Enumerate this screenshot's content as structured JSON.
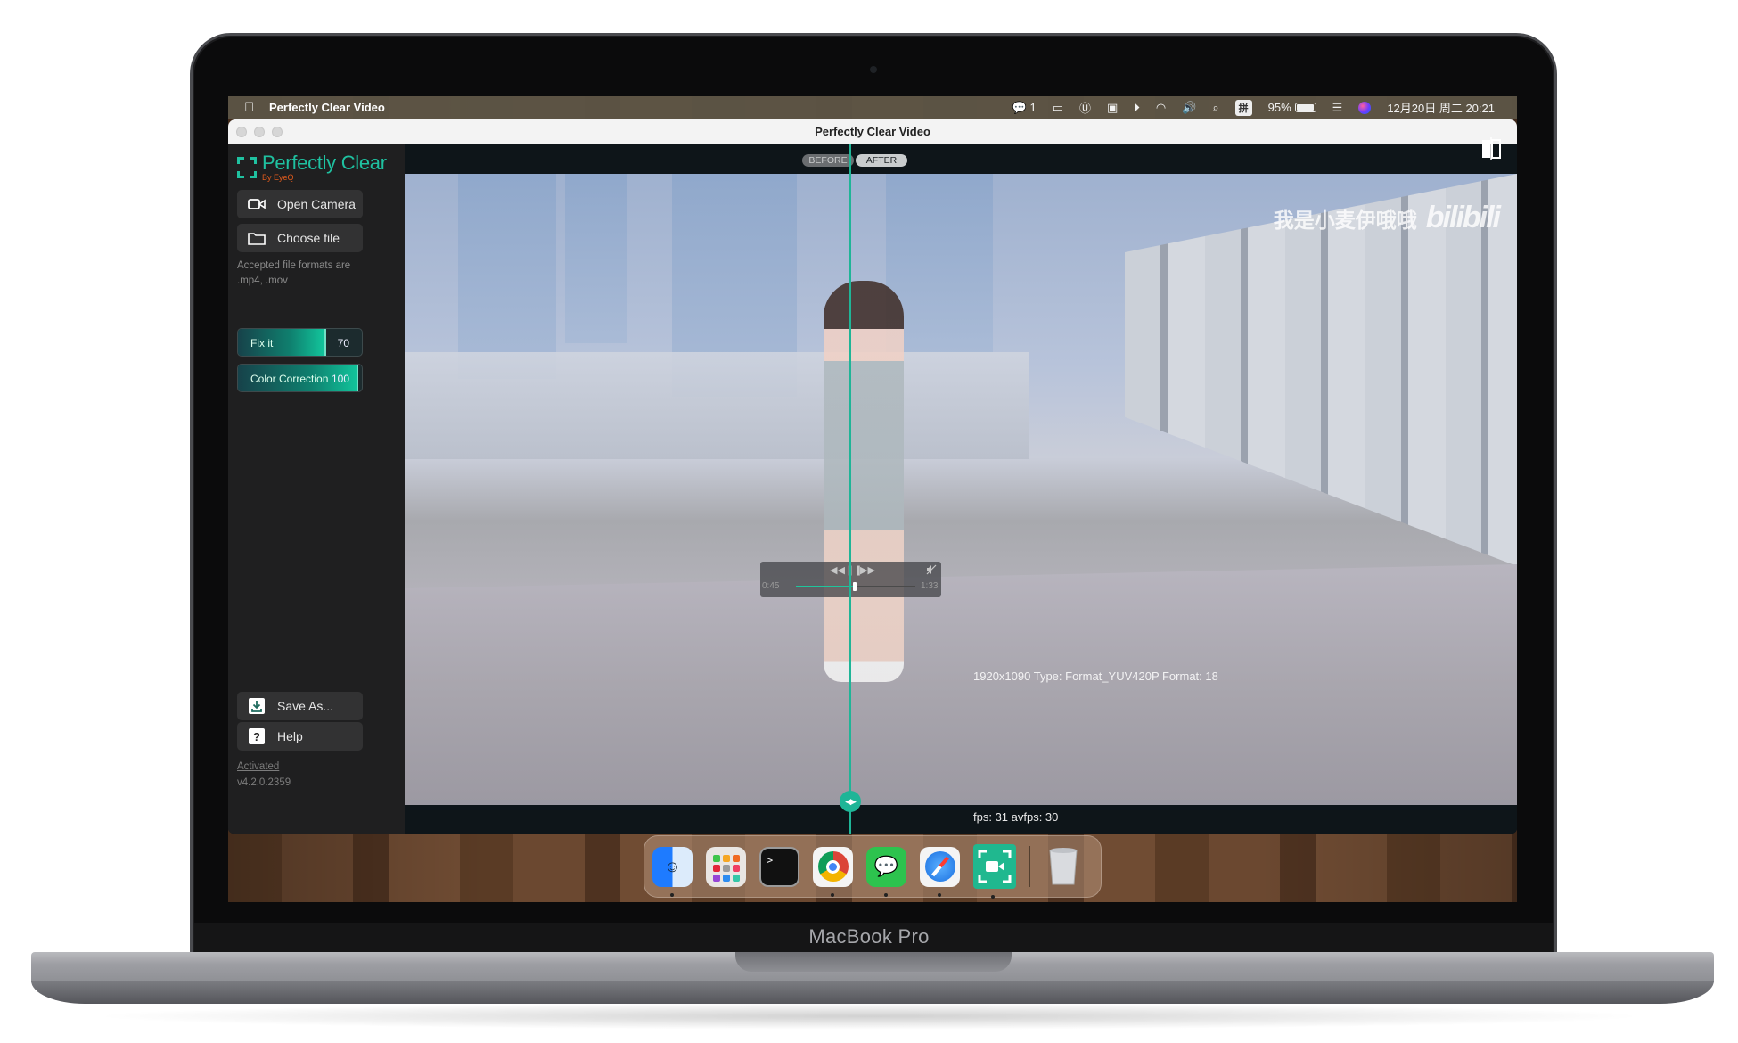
{
  "device": {
    "brand_label": "MacBook Pro"
  },
  "menubar": {
    "apple_icon": "apple-logo",
    "app_name": "Perfectly Clear Video",
    "status_items": [
      {
        "name": "wechat-icon",
        "text": "1"
      },
      {
        "name": "screen-mirror-icon",
        "text": ""
      },
      {
        "name": "u-app-icon",
        "text": ""
      },
      {
        "name": "image-app-icon",
        "text": ""
      },
      {
        "name": "play-icon",
        "text": ""
      },
      {
        "name": "wifi-icon",
        "text": ""
      },
      {
        "name": "volume-icon",
        "text": ""
      },
      {
        "name": "search-icon",
        "text": ""
      },
      {
        "name": "input-method-icon",
        "text": "拼"
      },
      {
        "name": "battery-percent",
        "text": "95%"
      },
      {
        "name": "control-center-icon",
        "text": ""
      },
      {
        "name": "siri-icon",
        "text": ""
      }
    ],
    "clock": "12月20日 周二 20:21"
  },
  "window": {
    "title": "Perfectly Clear Video"
  },
  "sidebar": {
    "logo": {
      "name": "Perfectly Clear",
      "tagline": "By EyeQ"
    },
    "open_camera_label": "Open Camera",
    "choose_file_label": "Choose file",
    "accepted_formats_hint": "Accepted file formats are .mp4, .mov",
    "sliders": [
      {
        "label": "Fix it",
        "value": "70",
        "fraction": 0.7
      },
      {
        "label": "Color Correction",
        "value": "100",
        "fraction": 1.0
      }
    ],
    "save_as_label": "Save As...",
    "help_label": "Help",
    "activation_status": "Activated",
    "version": "v4.2.0.2359"
  },
  "viewer": {
    "before_label": "BEFORE",
    "after_label": "AFTER",
    "watermark_text": "我是小麦伊哦哦",
    "watermark_brand": "bilibili",
    "split_position_fraction": 0.5,
    "player": {
      "rewind_icon": "◀◀",
      "pause_icon": "❚❚",
      "forward_icon": "▶▶",
      "mute_icon": "muted-speaker",
      "current_time": "0:45",
      "duration": "1:33",
      "progress_fraction": 0.49
    },
    "stream_info": "1920x1090 Type: Format_YUV420P Format: 18",
    "fps_info": "fps: 31 avfps: 30"
  },
  "dock": {
    "apps": [
      {
        "name": "Finder",
        "running": true
      },
      {
        "name": "Launchpad",
        "running": false
      },
      {
        "name": "Terminal",
        "running": false
      },
      {
        "name": "Google Chrome",
        "running": true
      },
      {
        "name": "WeChat",
        "running": true
      },
      {
        "name": "Safari",
        "running": true
      },
      {
        "name": "Perfectly Clear Video",
        "running": true
      },
      {
        "name": "Trash",
        "running": false
      }
    ]
  },
  "colors": {
    "accent": "#1fb597",
    "logo_green": "#1fc1a0",
    "logo_orange": "#e05a1c",
    "sidebar_bg": "#1f1f20",
    "viewer_bg": "#0e1519"
  }
}
